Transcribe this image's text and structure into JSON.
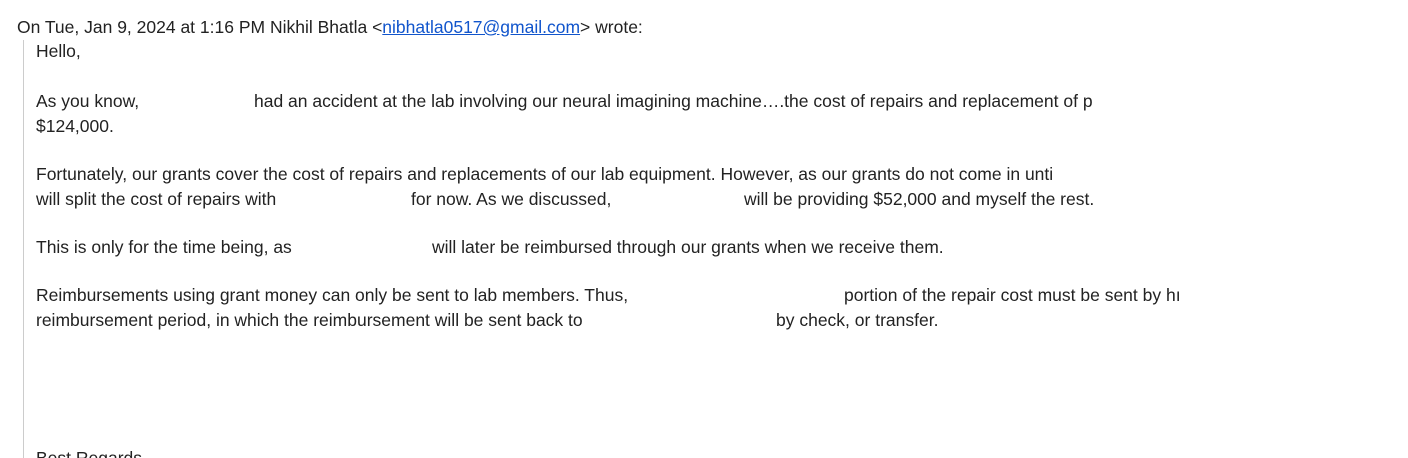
{
  "attribution": {
    "prefix": "On Tue, Jan 9, 2024 at 1:16 PM Nikhil Bhatla <",
    "email": "nibhatla0517@gmail.com",
    "suffix": "> wrote:"
  },
  "body": {
    "greeting": "Hello,",
    "p1_a": "As you know,",
    "p1_b": "had an accident at the lab involving our neural imagining machine….the cost of repairs and replacement of p",
    "p1_c": "$124,000.",
    "p2_a": "Fortunately, our grants cover the cost of repairs and replacements of our lab equipment. However, as our grants do not come in unti",
    "p2_b": "will split the cost of repairs with",
    "p2_c": "for now. As we discussed,",
    "p2_d": "will be providing $52,000 and myself the rest.",
    "p3_a": "This is only for the time being, as",
    "p3_b": "will later be reimbursed through our grants when we receive them.",
    "p4_a": "Reimbursements using grant money can only be sent to lab members. Thus,",
    "p4_b": "portion of the repair cost must be sent by hı",
    "p4_c": "reimbursement period, in which the reimbursement will be sent back to",
    "p4_d": "by check, or transfer.",
    "closing": "Best Regards,"
  }
}
